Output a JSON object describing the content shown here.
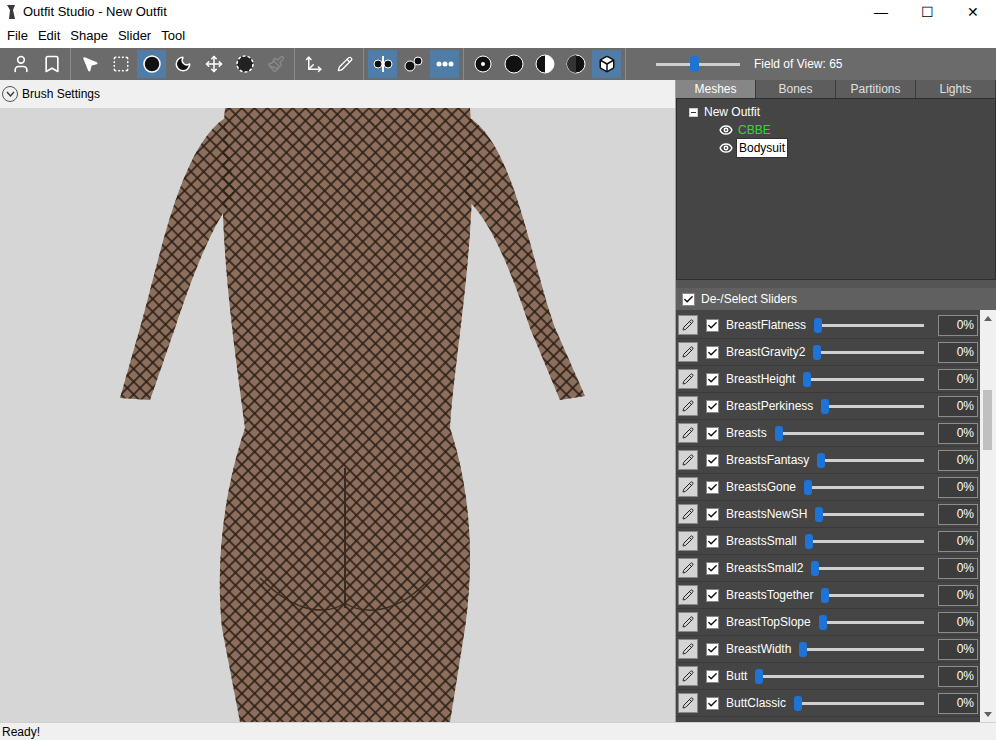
{
  "window": {
    "title": "Outfit Studio - New Outfit",
    "controls": [
      "—",
      "☐",
      "✕"
    ]
  },
  "menu": [
    "File",
    "Edit",
    "Shape",
    "Slider",
    "Tool"
  ],
  "toolbar": {
    "groups": [
      [
        {
          "selected": false
        },
        {
          "selected": false
        }
      ],
      [
        {
          "selected": false
        },
        {
          "selected": false
        },
        {
          "selected": true
        },
        {
          "selected": false
        },
        {
          "selected": false
        },
        {
          "selected": false
        },
        {
          "selected": false,
          "disabled": true
        }
      ],
      [
        {
          "selected": false
        },
        {
          "selected": false
        }
      ],
      [
        {
          "selected": true
        },
        {
          "selected": false
        },
        {
          "selected": true
        }
      ],
      [
        {
          "selected": false
        },
        {
          "selected": false
        },
        {
          "selected": false
        },
        {
          "selected": false
        },
        {
          "selected": true
        }
      ]
    ],
    "fov": {
      "label": "Field of View: 65",
      "level": 0.45
    }
  },
  "brush_settings": {
    "label": "Brush Settings",
    "expanded": false
  },
  "tabs": [
    {
      "label": "Meshes",
      "selected": true
    },
    {
      "label": "Bones",
      "selected": false
    },
    {
      "label": "Partitions",
      "selected": false
    },
    {
      "label": "Lights",
      "selected": false
    }
  ],
  "tree": {
    "root": {
      "label": "New Outfit",
      "expanded": true
    },
    "items": [
      {
        "label": "CBBE",
        "visible": true,
        "selected": false,
        "color": "#22e022"
      },
      {
        "label": "Bodysuit",
        "visible": true,
        "selected": true,
        "color": "#ffffff"
      }
    ]
  },
  "sliders_header": {
    "label": "De-/Select Sliders",
    "checked": true
  },
  "sliders": [
    {
      "name": "BreastFlatness",
      "checked": true,
      "level": 0,
      "value": "0%"
    },
    {
      "name": "BreastGravity2",
      "checked": true,
      "level": 0,
      "value": "0%"
    },
    {
      "name": "BreastHeight",
      "checked": true,
      "level": 0,
      "value": "0%"
    },
    {
      "name": "BreastPerkiness",
      "checked": true,
      "level": 0,
      "value": "0%"
    },
    {
      "name": "Breasts",
      "checked": true,
      "level": 0,
      "value": "0%"
    },
    {
      "name": "BreastsFantasy",
      "checked": true,
      "level": 0,
      "value": "0%"
    },
    {
      "name": "BreastsGone",
      "checked": true,
      "level": 0,
      "value": "0%"
    },
    {
      "name": "BreastsNewSH",
      "checked": true,
      "level": 0,
      "value": "0%"
    },
    {
      "name": "BreastsSmall",
      "checked": true,
      "level": 0,
      "value": "0%"
    },
    {
      "name": "BreastsSmall2",
      "checked": true,
      "level": 0,
      "value": "0%"
    },
    {
      "name": "BreastsTogether",
      "checked": true,
      "level": 0,
      "value": "0%"
    },
    {
      "name": "BreastTopSlope",
      "checked": true,
      "level": 0,
      "value": "0%"
    },
    {
      "name": "BreastWidth",
      "checked": true,
      "level": 0,
      "value": "0%"
    },
    {
      "name": "Butt",
      "checked": true,
      "level": 0,
      "value": "0%"
    },
    {
      "name": "ButtClassic",
      "checked": true,
      "level": 0,
      "value": "0%"
    }
  ],
  "scrollbar": {
    "level": 0.2
  },
  "status_bar": "Ready!"
}
